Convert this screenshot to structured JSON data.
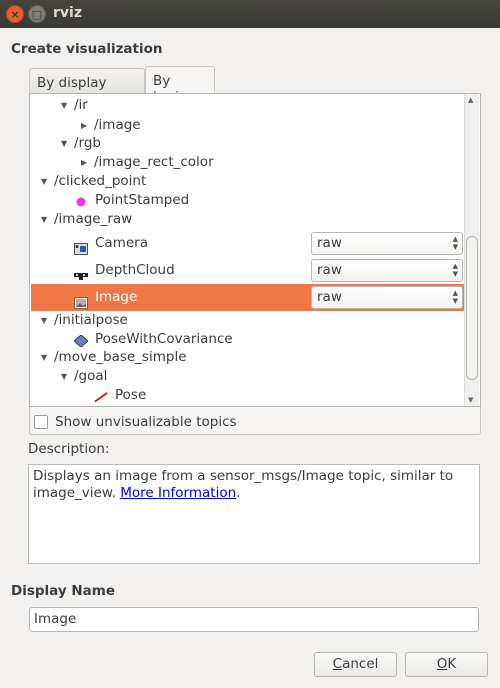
{
  "window": {
    "title": "rviz"
  },
  "heading": "Create visualization",
  "tabs": [
    {
      "label": "By display type",
      "active": false
    },
    {
      "label": "By topic",
      "active": true
    }
  ],
  "tree": [
    {
      "label": "/ir",
      "level": 1,
      "toggle": "expanded"
    },
    {
      "label": "/image",
      "level": 2,
      "toggle": "collapsed"
    },
    {
      "label": "/rgb",
      "level": 1,
      "toggle": "expanded"
    },
    {
      "label": "/image_rect_color",
      "level": 2,
      "toggle": "collapsed"
    },
    {
      "label": "/clicked_point",
      "level": 0,
      "toggle": "expanded"
    },
    {
      "label": "PointStamped",
      "level": 1,
      "icon": "point-icon"
    },
    {
      "label": "/image_raw",
      "level": 0,
      "toggle": "expanded"
    },
    {
      "label": "Camera",
      "level": 1,
      "icon": "camera-icon",
      "combo": "raw"
    },
    {
      "label": "DepthCloud",
      "level": 1,
      "icon": "depthcloud-icon",
      "combo": "raw"
    },
    {
      "label": "Image",
      "level": 1,
      "icon": "image-icon",
      "combo": "raw",
      "selected": true
    },
    {
      "label": "/initialpose",
      "level": 0,
      "toggle": "expanded"
    },
    {
      "label": "PoseWithCovariance",
      "level": 1,
      "icon": "pose-covariance-icon"
    },
    {
      "label": "/move_base_simple",
      "level": 0,
      "toggle": "expanded"
    },
    {
      "label": "/goal",
      "level": 1,
      "toggle": "expanded"
    },
    {
      "label": "Pose",
      "level": 2,
      "icon": "pose-arrow-icon"
    }
  ],
  "show_unvisualizable": {
    "label": "Show unvisualizable topics",
    "checked": false
  },
  "description": {
    "label": "Description:",
    "text": "Displays an image from a sensor_msgs/Image topic, similar to image_view. ",
    "link": "More Information",
    "after": "."
  },
  "display_name": {
    "label": "Display Name",
    "value": "Image"
  },
  "buttons": {
    "cancel": "Cancel",
    "ok": "OK"
  },
  "colors": {
    "selection": "#f07746",
    "link": "#0000ee",
    "titlebar": "#3c3b37"
  }
}
